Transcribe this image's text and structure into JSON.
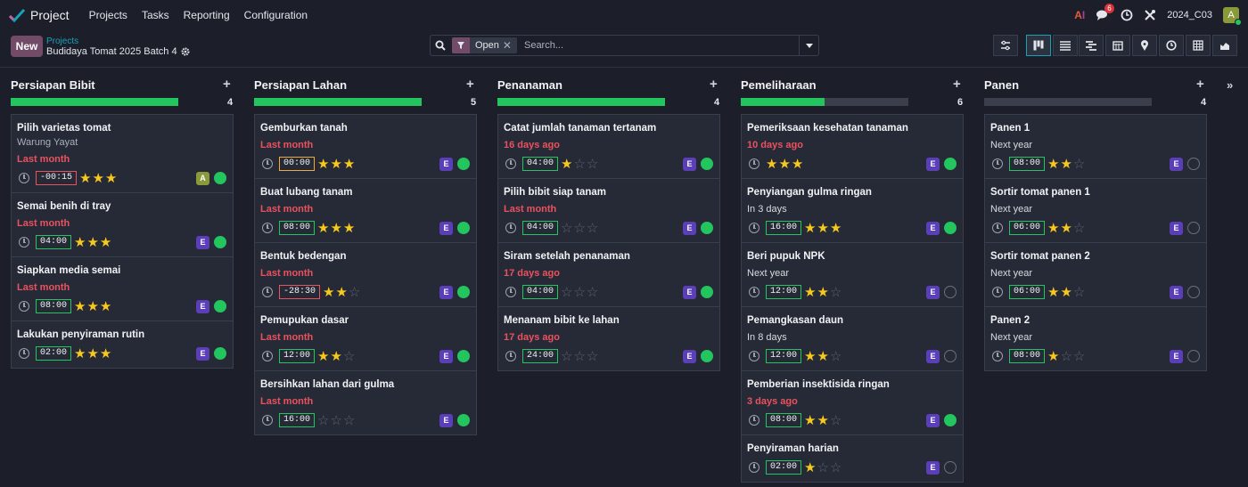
{
  "app": {
    "title": "Project"
  },
  "menu": [
    "Projects",
    "Tasks",
    "Reporting",
    "Configuration"
  ],
  "nav_right": {
    "ai_label_a": "A",
    "ai_label_i": "I",
    "chat_badge": "6",
    "company": "2024_C03",
    "avatar": "A"
  },
  "control": {
    "new_label": "New",
    "crumb_parent": "Projects",
    "crumb_current": "Budidaya Tomat 2025 Batch 4",
    "facet_label": "Open",
    "search_placeholder": "Search..."
  },
  "columns": [
    {
      "title": "Persiapan Bibit",
      "count": "4",
      "progress": 1.0,
      "cards": [
        {
          "title": "Pilih varietas tomat",
          "subtitle": "Warung Yayat",
          "date": "Last month",
          "date_style": "red",
          "time": "-00:15",
          "time_style": "neg",
          "stars": 3,
          "avatar": "A",
          "avatar_style": "a",
          "state": "green"
        },
        {
          "title": "Semai benih di tray",
          "subtitle": "",
          "date": "Last month",
          "date_style": "red",
          "time": "04:00",
          "time_style": "pos",
          "stars": 3,
          "avatar": "E",
          "avatar_style": "e",
          "state": "green"
        },
        {
          "title": "Siapkan media semai",
          "subtitle": "",
          "date": "Last month",
          "date_style": "red",
          "time": "08:00",
          "time_style": "pos",
          "stars": 3,
          "avatar": "E",
          "avatar_style": "e",
          "state": "green"
        },
        {
          "title": "Lakukan penyiraman rutin",
          "subtitle": "",
          "date": "",
          "date_style": "none",
          "time": "02:00",
          "time_style": "pos",
          "stars": 3,
          "avatar": "E",
          "avatar_style": "e",
          "state": "green"
        }
      ]
    },
    {
      "title": "Persiapan Lahan",
      "count": "5",
      "progress": 1.0,
      "cards": [
        {
          "title": "Gemburkan tanah",
          "subtitle": "",
          "date": "Last month",
          "date_style": "red",
          "time": "00:00",
          "time_style": "ok",
          "stars": 3,
          "avatar": "E",
          "avatar_style": "e",
          "state": "green"
        },
        {
          "title": "Buat lubang tanam",
          "subtitle": "",
          "date": "Last month",
          "date_style": "red",
          "time": "08:00",
          "time_style": "pos",
          "stars": 3,
          "avatar": "E",
          "avatar_style": "e",
          "state": "green"
        },
        {
          "title": "Bentuk bedengan",
          "subtitle": "",
          "date": "Last month",
          "date_style": "red",
          "time": "-28:30",
          "time_style": "neg",
          "stars": 2,
          "avatar": "E",
          "avatar_style": "e",
          "state": "green"
        },
        {
          "title": "Pemupukan dasar",
          "subtitle": "",
          "date": "Last month",
          "date_style": "red",
          "time": "12:00",
          "time_style": "pos",
          "stars": 2,
          "avatar": "E",
          "avatar_style": "e",
          "state": "green"
        },
        {
          "title": "Bersihkan lahan dari gulma",
          "subtitle": "",
          "date": "Last month",
          "date_style": "red",
          "time": "16:00",
          "time_style": "pos",
          "stars": 0,
          "avatar": "E",
          "avatar_style": "e",
          "state": "green"
        }
      ]
    },
    {
      "title": "Penanaman",
      "count": "4",
      "progress": 1.0,
      "cards": [
        {
          "title": "Catat jumlah tanaman tertanam",
          "subtitle": "",
          "date": "16 days ago",
          "date_style": "red",
          "time": "04:00",
          "time_style": "pos",
          "stars": 1,
          "avatar": "E",
          "avatar_style": "e",
          "state": "green"
        },
        {
          "title": "Pilih bibit siap tanam",
          "subtitle": "",
          "date": "Last month",
          "date_style": "red",
          "time": "04:00",
          "time_style": "pos",
          "stars": 0,
          "avatar": "E",
          "avatar_style": "e",
          "state": "green"
        },
        {
          "title": "Siram setelah penanaman",
          "subtitle": "",
          "date": "17 days ago",
          "date_style": "red",
          "time": "04:00",
          "time_style": "pos",
          "stars": 0,
          "avatar": "E",
          "avatar_style": "e",
          "state": "green"
        },
        {
          "title": "Menanam bibit ke lahan",
          "subtitle": "",
          "date": "17 days ago",
          "date_style": "red",
          "time": "24:00",
          "time_style": "pos",
          "stars": 0,
          "avatar": "E",
          "avatar_style": "e",
          "state": "green"
        }
      ]
    },
    {
      "title": "Pemeliharaan",
      "count": "6",
      "progress": 0.5,
      "cards": [
        {
          "title": "Pemeriksaan kesehatan tanaman",
          "subtitle": "",
          "date": "10 days ago",
          "date_style": "red",
          "time": "",
          "time_style": "none",
          "stars": 3,
          "avatar": "E",
          "avatar_style": "e",
          "state": "green"
        },
        {
          "title": "Penyiangan gulma ringan",
          "subtitle": "",
          "date": "In 3 days",
          "date_style": "normal",
          "time": "16:00",
          "time_style": "pos",
          "stars": 3,
          "avatar": "E",
          "avatar_style": "e",
          "state": "green"
        },
        {
          "title": "Beri pupuk NPK",
          "subtitle": "",
          "date": "Next year",
          "date_style": "normal",
          "time": "12:00",
          "time_style": "pos",
          "stars": 2,
          "avatar": "E",
          "avatar_style": "e",
          "state": "empty"
        },
        {
          "title": "Pemangkasan daun",
          "subtitle": "",
          "date": "In 8 days",
          "date_style": "normal",
          "time": "12:00",
          "time_style": "pos",
          "stars": 2,
          "avatar": "E",
          "avatar_style": "e",
          "state": "empty"
        },
        {
          "title": "Pemberian insektisida ringan",
          "subtitle": "",
          "date": "3 days ago",
          "date_style": "red",
          "time": "08:00",
          "time_style": "pos",
          "stars": 2,
          "avatar": "E",
          "avatar_style": "e",
          "state": "green"
        },
        {
          "title": "Penyiraman harian",
          "subtitle": "",
          "date": "",
          "date_style": "none",
          "time": "02:00",
          "time_style": "pos",
          "stars": 1,
          "avatar": "E",
          "avatar_style": "e",
          "state": "empty"
        }
      ]
    },
    {
      "title": "Panen",
      "count": "4",
      "progress": 0.0,
      "cards": [
        {
          "title": "Panen 1",
          "subtitle": "",
          "date": "Next year",
          "date_style": "normal",
          "time": "08:00",
          "time_style": "pos",
          "stars": 2,
          "avatar": "E",
          "avatar_style": "e",
          "state": "empty"
        },
        {
          "title": "Sortir tomat panen 1",
          "subtitle": "",
          "date": "Next year",
          "date_style": "normal",
          "time": "06:00",
          "time_style": "pos",
          "stars": 2,
          "avatar": "E",
          "avatar_style": "e",
          "state": "empty"
        },
        {
          "title": "Sortir tomat panen 2",
          "subtitle": "",
          "date": "Next year",
          "date_style": "normal",
          "time": "06:00",
          "time_style": "pos",
          "stars": 2,
          "avatar": "E",
          "avatar_style": "e",
          "state": "empty"
        },
        {
          "title": "Panen 2",
          "subtitle": "",
          "date": "Next year",
          "date_style": "normal",
          "time": "08:00",
          "time_style": "pos",
          "stars": 1,
          "avatar": "E",
          "avatar_style": "e",
          "state": "empty"
        }
      ]
    }
  ],
  "colors": {
    "accent": "#714b67",
    "progress": "#22c55e",
    "overdue": "#e9525f",
    "star": "#f7c81e"
  }
}
